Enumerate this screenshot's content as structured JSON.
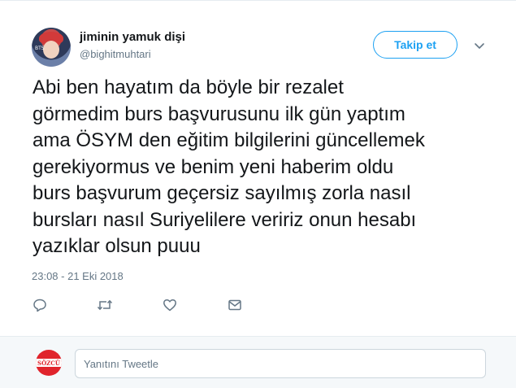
{
  "user": {
    "display_name": "jiminin yamuk dişi",
    "handle": "@bighitmuhtari",
    "avatar_tag": "BTS"
  },
  "follow_button_label": "Takip et",
  "tweet": {
    "lines": [
      "Abi ben hayatım da böyle bir rezalet",
      "görmedim burs başvurusunu ilk gün yaptım",
      "ama ÖSYM den eğitim bilgilerini güncellemek",
      "gerekiyormus ve benim yeni haberim oldu",
      "burs başvurum geçersiz sayılmış zorla nasıl",
      "bursları nasıl Suriyelilere veririz onun hesabı",
      "yazıklar olsun puuu"
    ],
    "timestamp": "23:08 - 21 Eki 2018"
  },
  "actions": [
    {
      "name": "reply-icon"
    },
    {
      "name": "retweet-icon"
    },
    {
      "name": "like-icon"
    },
    {
      "name": "message-icon"
    }
  ],
  "reply": {
    "placeholder": "Yanıtını Tweetle",
    "avatar_logo_text": "SÖZCÜ"
  },
  "colors": {
    "accent": "#1da1f2",
    "text": "#14171a",
    "secondary": "#657786",
    "border": "#e6ecf0",
    "reply_bg": "#f5f8fa",
    "reply_avatar": "#e0242c"
  }
}
